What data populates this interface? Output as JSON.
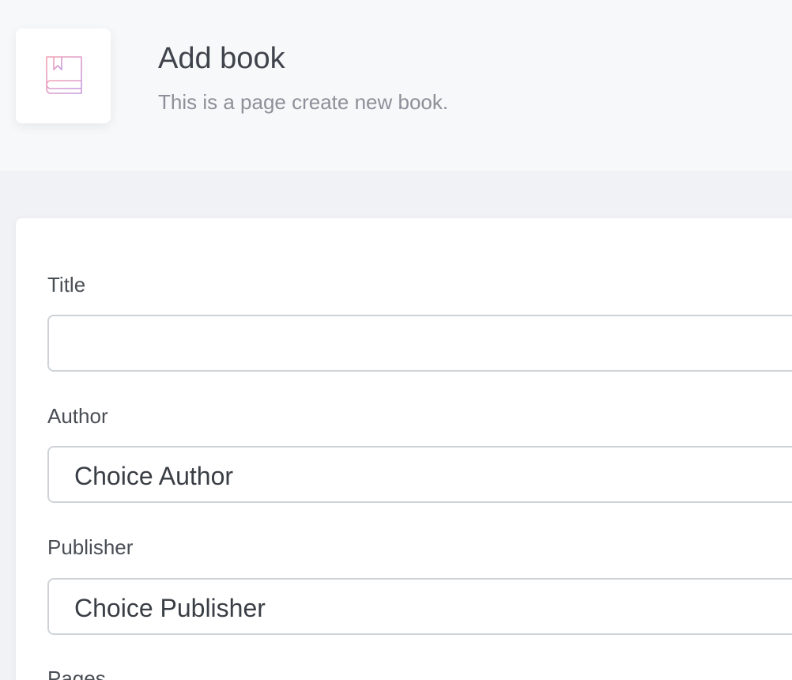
{
  "header": {
    "icon": "book-icon",
    "title": "Add book",
    "subtitle": "This is a page create new book."
  },
  "form": {
    "title_label": "Title",
    "title_value": "",
    "author_label": "Author",
    "author_selected": "Choice Author",
    "publisher_label": "Publisher",
    "publisher_selected": "Choice Publisher",
    "pages_label": "Pages"
  },
  "colors": {
    "icon_gradient_start": "#f3a1b4",
    "icon_gradient_end": "#c79ae0"
  }
}
